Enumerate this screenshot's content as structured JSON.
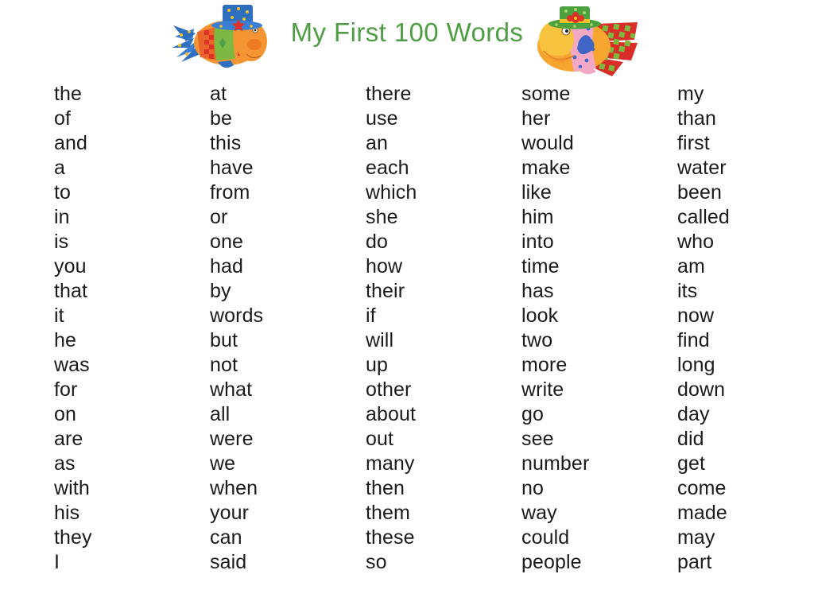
{
  "header": {
    "title": "My First 100 Words",
    "title_color": "#4f9e45",
    "left_fish": {
      "name": "fish-with-blue-top-hat",
      "hat_color": "#2f6fc0",
      "hat_dot_color": "#f2c12e",
      "star_color": "#e03127",
      "head_color": "#f59432",
      "body_colors": [
        "#7cb842",
        "#f08a2c",
        "#e03127"
      ],
      "tail_color": "#2f6fc0"
    },
    "right_fish": {
      "name": "fish-with-green-hat",
      "hat_color": "#4ba23f",
      "hat_dot_color": "#a8d46a",
      "flower_color": "#e03127",
      "head_color": "#f6a62e",
      "body_color": "#f3a8c6",
      "body_dot_color": "#3f66c4",
      "star_color": "#3f66c4",
      "tail_colors": [
        "#d92d27",
        "#7cb842"
      ]
    }
  },
  "word_list": {
    "total_count": 100,
    "rows_per_column": 20,
    "text_color": "#1b1b1b",
    "columns": [
      {
        "index": 1,
        "name": "column-1",
        "words": [
          "the",
          "of",
          "and",
          "a",
          "to",
          "in",
          "is",
          "you",
          "that",
          "it",
          "he",
          "was",
          "for",
          "on",
          "are",
          "as",
          "with",
          "his",
          "they",
          "I"
        ]
      },
      {
        "index": 2,
        "name": "column-2",
        "words": [
          "at",
          "be",
          "this",
          "have",
          "from",
          "or",
          "one",
          "had",
          "by",
          "words",
          "but",
          "not",
          "what",
          "all",
          "were",
          "we",
          "when",
          "your",
          "can",
          "said"
        ]
      },
      {
        "index": 3,
        "name": "column-3",
        "words": [
          "there",
          "use",
          "an",
          "each",
          "which",
          "she",
          "do",
          "how",
          "their",
          "if",
          "will",
          "up",
          "other",
          "about",
          "out",
          "many",
          "then",
          "them",
          "these",
          "so"
        ]
      },
      {
        "index": 4,
        "name": "column-4",
        "words": [
          "some",
          "her",
          "would",
          "make",
          "like",
          "him",
          "into",
          "time",
          "has",
          "look",
          "two",
          "more",
          "write",
          "go",
          "see",
          "number",
          "no",
          "way",
          "could",
          "people"
        ]
      },
      {
        "index": 5,
        "name": "column-5",
        "words": [
          "my",
          "than",
          "first",
          "water",
          "been",
          "called",
          "who",
          "am",
          "its",
          "now",
          "find",
          "long",
          "down",
          "day",
          "did",
          "get",
          "come",
          "made",
          "may",
          "part"
        ]
      }
    ]
  }
}
